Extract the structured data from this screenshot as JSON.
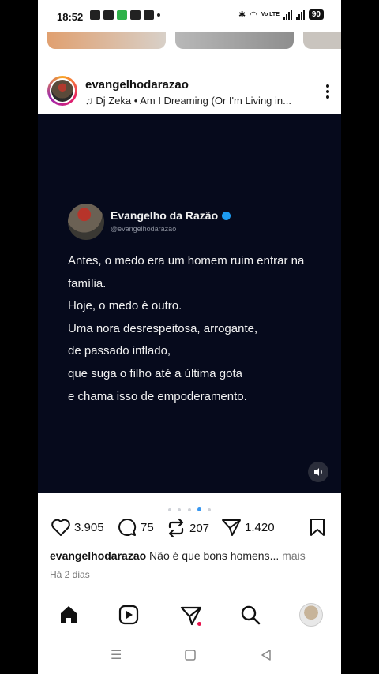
{
  "status_bar": {
    "time": "18:52",
    "network_label": "Vo LTE",
    "battery": "90"
  },
  "post": {
    "username": "evangelhodarazao",
    "music": "Dj Zeka • Am I Dreaming (Or I'm Living in...",
    "tweet": {
      "name": "Evangelho da Razão",
      "handle": "@evangelhodarazao",
      "lines": [
        "Antes, o medo era um homem ruim entrar na",
        "família.",
        "Hoje, o medo é outro.",
        "Uma nora desrespeitosa, arrogante,",
        "de passado inflado,",
        "que suga o filho até a última gota",
        "e chama isso de empoderamento."
      ]
    },
    "carousel": {
      "count": 5,
      "active_index": 3
    },
    "likes": "3.905",
    "comments": "75",
    "reposts": "207",
    "shares": "1.420",
    "caption_user": "evangelhodarazao",
    "caption_text": " Não é que bons homens...",
    "caption_more": " mais",
    "date": "Há 2 dias"
  },
  "nav": {
    "items": [
      "home-icon",
      "reels-icon",
      "messages-icon",
      "search-icon",
      "profile-avatar"
    ]
  },
  "colors": {
    "media_bg": "#060a1c",
    "verified": "#1d9bf0",
    "notification": "#e8124c",
    "active_dot": "#3897f0"
  }
}
